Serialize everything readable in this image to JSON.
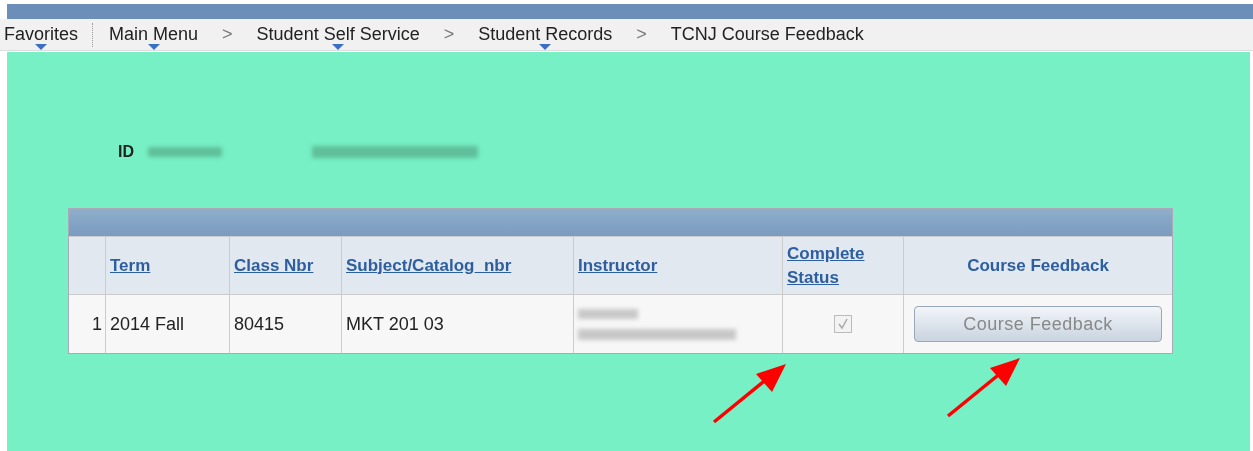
{
  "nav": [
    {
      "label": "Favorites",
      "has_menu": true
    },
    {
      "label": "Main Menu",
      "has_menu": true
    },
    {
      "separator": ">",
      "label": "Student Self Service",
      "has_menu": true
    },
    {
      "separator": ">",
      "label": "Student Records",
      "has_menu": true
    },
    {
      "separator": ">",
      "label": "TCNJ Course Feedback",
      "has_menu": false
    }
  ],
  "id_label": "ID",
  "table": {
    "columns": [
      {
        "label": "Term",
        "sortable": true
      },
      {
        "label": "Class Nbr",
        "sortable": true
      },
      {
        "label": "Subject/Catalog_nbr",
        "sortable": true
      },
      {
        "label": "Instructor",
        "sortable": true
      },
      {
        "label": "Complete Status",
        "sortable": true
      },
      {
        "label": "Course Feedback",
        "sortable": false
      }
    ],
    "rows": [
      {
        "number": "1",
        "term": "2014 Fall",
        "class_nbr": "80415",
        "subject": "MKT 201 03",
        "complete": {
          "checked": true,
          "disabled": true
        },
        "button": {
          "label": "Course Feedback",
          "disabled": true
        }
      }
    ]
  }
}
